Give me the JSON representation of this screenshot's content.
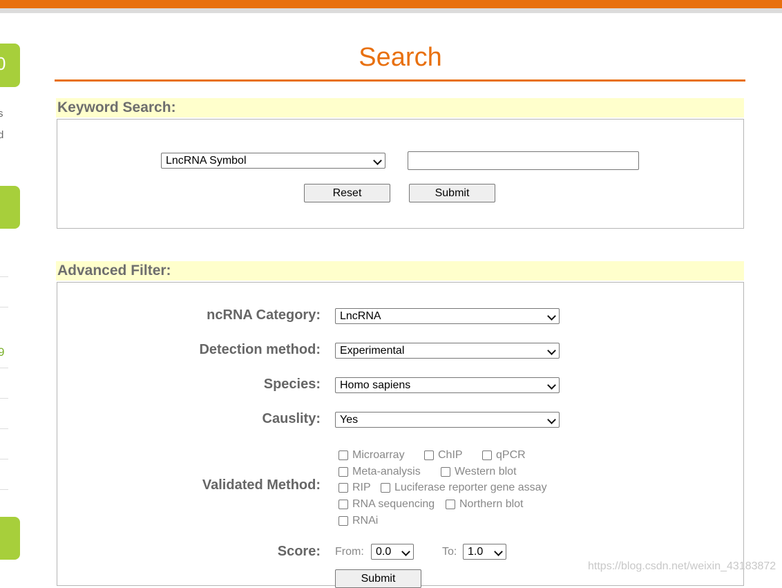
{
  "sidebar": {
    "tab1_text": "0",
    "text1": "s",
    "text2": "d",
    "num": "9"
  },
  "page": {
    "title": "Search"
  },
  "keyword": {
    "heading": "Keyword Search:",
    "field_select": "LncRNA Symbol",
    "input_value": "",
    "reset_label": "Reset",
    "submit_label": "Submit"
  },
  "advanced": {
    "heading": "Advanced Filter:",
    "category_label": "ncRNA Category:",
    "category_value": "LncRNA",
    "detection_label": "Detection method:",
    "detection_value": "Experimental",
    "species_label": "Species:",
    "species_value": "Homo sapiens",
    "causality_label": "Causlity:",
    "causality_value": "Yes",
    "validated_label": "Validated Method:",
    "methods": [
      "Microarray",
      "ChIP",
      "qPCR",
      "Meta-analysis",
      "Western blot",
      "RIP",
      "Luciferase reporter gene assay",
      "RNA sequencing",
      "Northern blot",
      "RNAi"
    ],
    "score_label": "Score:",
    "from_label": "From:",
    "from_value": "0.0",
    "to_label": "To:",
    "to_value": "1.0",
    "submit_label": "Submit"
  },
  "watermark": "https://blog.csdn.net/weixin_43183872",
  "colors": {
    "accent": "#e8700f",
    "sidebar_green": "#a7cf3b",
    "section_bg": "#ffffcc"
  }
}
